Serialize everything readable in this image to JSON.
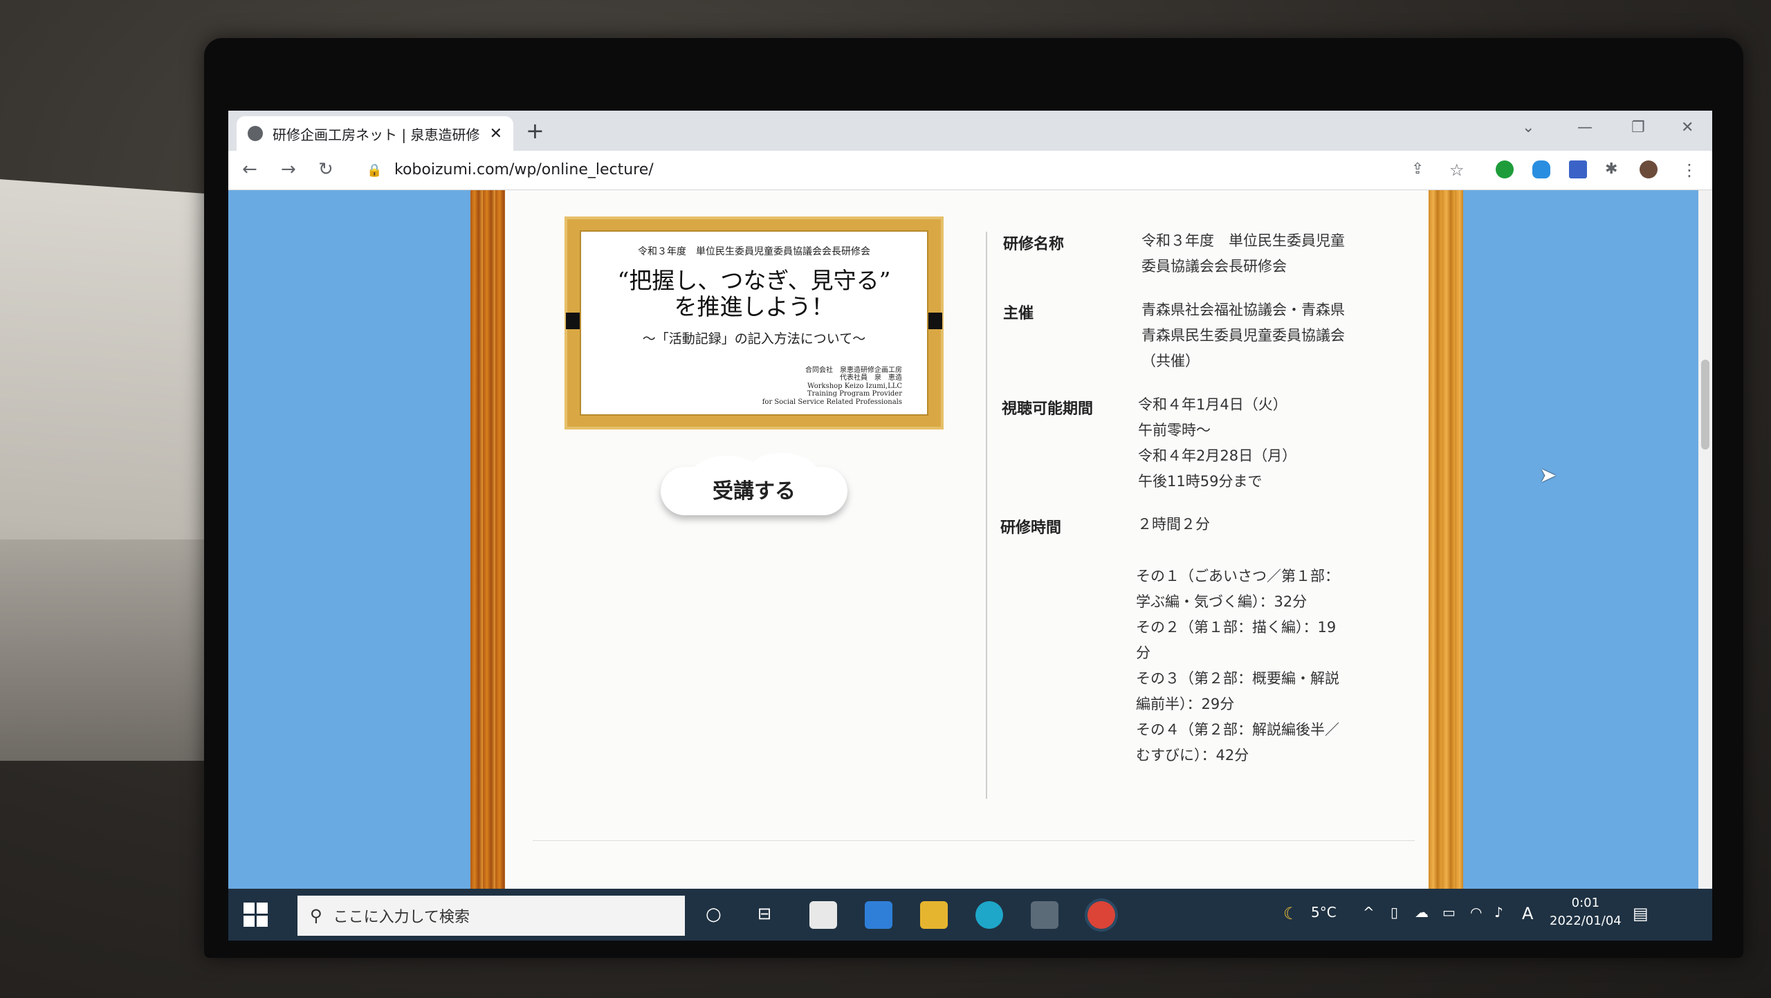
{
  "browser": {
    "tab_title": "研修企画工房ネット | 泉恵造研修企",
    "tab_close": "✕",
    "new_tab": "+",
    "url": "koboizumi.com/wp/online_lecture/",
    "nav": {
      "back": "←",
      "forward": "→",
      "reload": "↻"
    }
  },
  "slide": {
    "top_line": "令和３年度　単位民生委員児童委員協議会会長研修会",
    "main_line1": "“把握し、つなぎ、見守る”",
    "main_line2": "を推進しよう！",
    "subtitle": "～「活動記録」の記入方法について～",
    "author_lines": [
      "合同会社　泉恵造研修企画工房",
      "代表社員　泉　恵造",
      "Workshop Keizo Izumi,LLC",
      "Training Program Provider",
      "for Social Service Related Professionals"
    ]
  },
  "cta": {
    "label": "受講する"
  },
  "info": {
    "name_label": "研修名称",
    "name_value": [
      "令和３年度　単位民生委員児童",
      "委員協議会会長研修会"
    ],
    "host_label": "主催",
    "host_value": [
      "青森県社会福祉協議会・青森県",
      "青森県民生委員児童委員協議会",
      "（共催）"
    ],
    "period_label": "視聴可能期間",
    "period_value": [
      "令和４年1月4日（火）",
      "午前零時～",
      "令和４年2月28日（月）",
      "午後11時59分まで"
    ],
    "time_label": "研修時間",
    "time_value": "２時間２分",
    "parts": [
      "その１（ごあいさつ／第１部：",
      "学ぶ編・気づく編）：32分",
      "その２（第１部：描く編）：19",
      "分",
      "その３（第２部：概要編・解説",
      "編前半）：29分",
      "その４（第２部：解説編後半／",
      "むすびに）：42分"
    ]
  },
  "taskbar": {
    "search_placeholder": "ここに入力して検索",
    "weather": "5°C",
    "time": "0:01",
    "date": "2022/01/04",
    "ime": "A"
  },
  "colors": {
    "page_bg": "#6aaae2",
    "taskbar": "#1f3243",
    "frame": "#d8801e"
  }
}
